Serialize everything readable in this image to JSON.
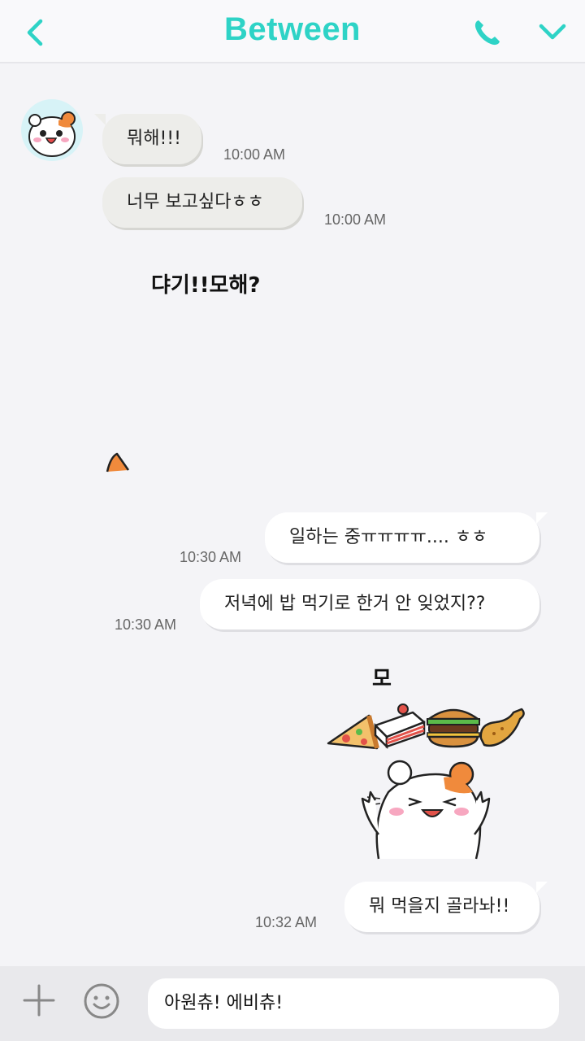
{
  "header": {
    "title": "Between",
    "back_icon": "chevron-left-icon",
    "call_icon": "phone-icon",
    "menu_icon": "chevron-down-icon",
    "accent_color": "#2ed3c6"
  },
  "messages": [
    {
      "direction": "incoming",
      "text": "뭐해!!!",
      "time": "10:00 AM"
    },
    {
      "direction": "incoming",
      "text": "너무 보고싶다ㅎㅎ",
      "time": "10:00 AM"
    },
    {
      "direction": "incoming",
      "type": "sticker",
      "text": "댜기!!모해?"
    },
    {
      "direction": "outgoing",
      "text": "일하는 중ㅠㅠㅠㅠ.... ㅎㅎ",
      "time": "10:30 AM"
    },
    {
      "direction": "outgoing",
      "text": "저녁에 밥 먹기로 한거 안 잊었지??",
      "time": "10:30 AM"
    },
    {
      "direction": "outgoing",
      "type": "sticker",
      "text": "모"
    },
    {
      "direction": "outgoing",
      "text": "뭐 먹을지 골라놔!!",
      "time": "10:32 AM"
    }
  ],
  "composer": {
    "input_value": "아원츄! 에비츄!",
    "plus_icon": "plus-icon",
    "emoji_icon": "smiley-icon"
  }
}
